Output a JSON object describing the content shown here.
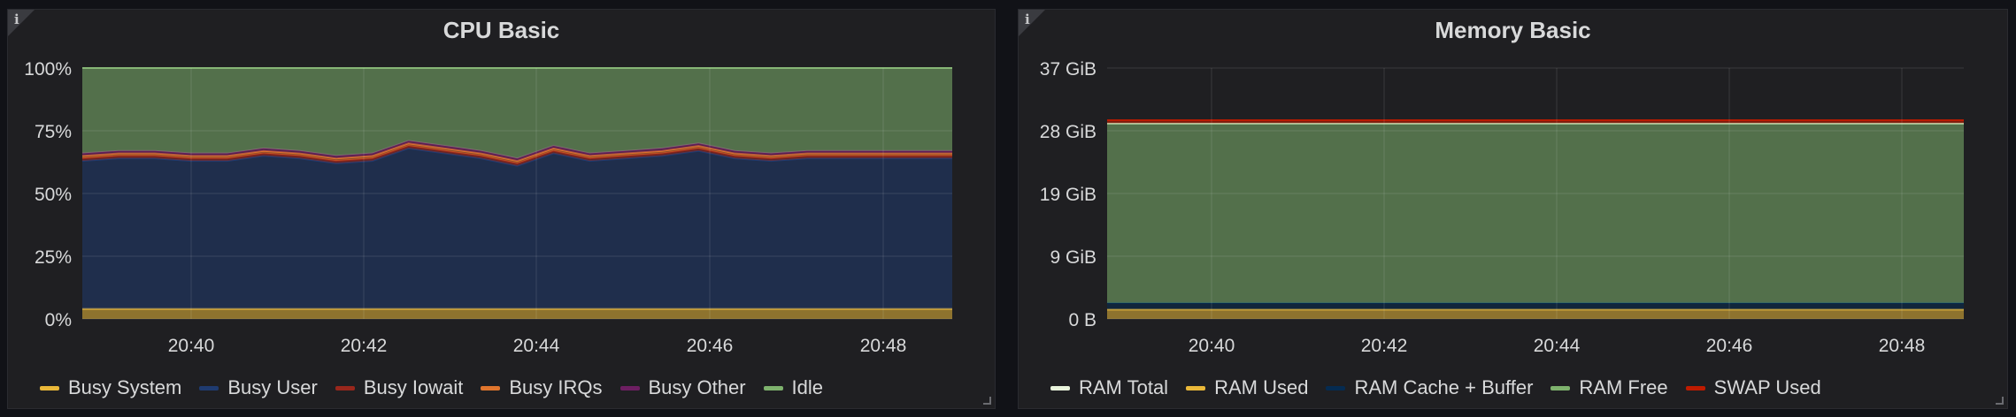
{
  "panels": [
    {
      "title": "CPU Basic",
      "info_icon": "info-icon",
      "chart_data": {
        "type": "area",
        "stacked": true,
        "x": [
          "20:39",
          "20:40",
          "20:41",
          "20:42",
          "20:43",
          "20:44",
          "20:45",
          "20:46",
          "20:47",
          "20:48",
          "20:49"
        ],
        "x_ticks": [
          "20:40",
          "20:42",
          "20:44",
          "20:46",
          "20:48"
        ],
        "y_ticks": [
          "0%",
          "25%",
          "50%",
          "75%",
          "100%"
        ],
        "ylim": [
          0,
          100
        ],
        "grid": true,
        "legend_position": "bottom-left",
        "series": [
          {
            "name": "Busy System",
            "color": "#eab839",
            "values": [
              4,
              4,
              4,
              4,
              4,
              4,
              4,
              4,
              4,
              4,
              4,
              4,
              4,
              4,
              4,
              4,
              4,
              4,
              4,
              4,
              4,
              4,
              4,
              4,
              4
            ]
          },
          {
            "name": "Busy User",
            "color": "#1f3b70",
            "values": [
              59,
              60,
              60,
              59,
              59,
              61,
              60,
              58,
              59,
              64,
              62,
              60,
              57,
              62,
              59,
              60,
              61,
              63,
              60,
              59,
              60,
              60,
              60,
              60,
              60
            ]
          },
          {
            "name": "Busy Iowait",
            "color": "#99271c",
            "values": [
              1,
              1,
              1,
              1,
              1,
              1,
              1,
              1,
              1,
              1,
              1,
              1,
              1,
              1,
              1,
              1,
              1,
              1,
              1,
              1,
              1,
              1,
              1,
              1,
              1
            ]
          },
          {
            "name": "Busy IRQs",
            "color": "#e0752d",
            "values": [
              1,
              1,
              1,
              1,
              1,
              1,
              1,
              1,
              1,
              1,
              1,
              1,
              1,
              1,
              1,
              1,
              1,
              1,
              1,
              1,
              1,
              1,
              1,
              1,
              1
            ]
          },
          {
            "name": "Busy Other",
            "color": "#6d1f62",
            "values": [
              1,
              1,
              1,
              1,
              1,
              1,
              1,
              1,
              1,
              1,
              1,
              1,
              1,
              1,
              1,
              1,
              1,
              1,
              1,
              1,
              1,
              1,
              1,
              1,
              1
            ]
          },
          {
            "name": "Idle",
            "color": "#7eb26d",
            "values": [
              34,
              33,
              33,
              34,
              34,
              32,
              33,
              35,
              34,
              29,
              31,
              33,
              36,
              31,
              34,
              33,
              32,
              30,
              33,
              34,
              33,
              33,
              33,
              33,
              33
            ]
          }
        ]
      }
    },
    {
      "title": "Memory Basic",
      "info_icon": "info-icon",
      "chart_data": {
        "type": "area",
        "stacked": true,
        "x_ticks": [
          "20:40",
          "20:42",
          "20:44",
          "20:46",
          "20:48"
        ],
        "y_ticks": [
          "0 B",
          "9 GiB",
          "19 GiB",
          "28 GiB",
          "37 GiB"
        ],
        "ylim": [
          0,
          37.5
        ],
        "grid": true,
        "legend_position": "bottom-left",
        "series": [
          {
            "name": "RAM Total",
            "color": "#e9f4dc",
            "values": [
              29.2
            ]
          },
          {
            "name": "RAM Used",
            "color": "#eab839",
            "values": [
              1.4
            ]
          },
          {
            "name": "RAM Cache + Buffer",
            "color": "#052b51",
            "values": [
              1.0
            ]
          },
          {
            "name": "RAM Free",
            "color": "#7eb26d",
            "values": [
              26.8
            ]
          },
          {
            "name": "SWAP Used",
            "color": "#bf1b00",
            "values": [
              0.5
            ]
          }
        ]
      }
    }
  ]
}
